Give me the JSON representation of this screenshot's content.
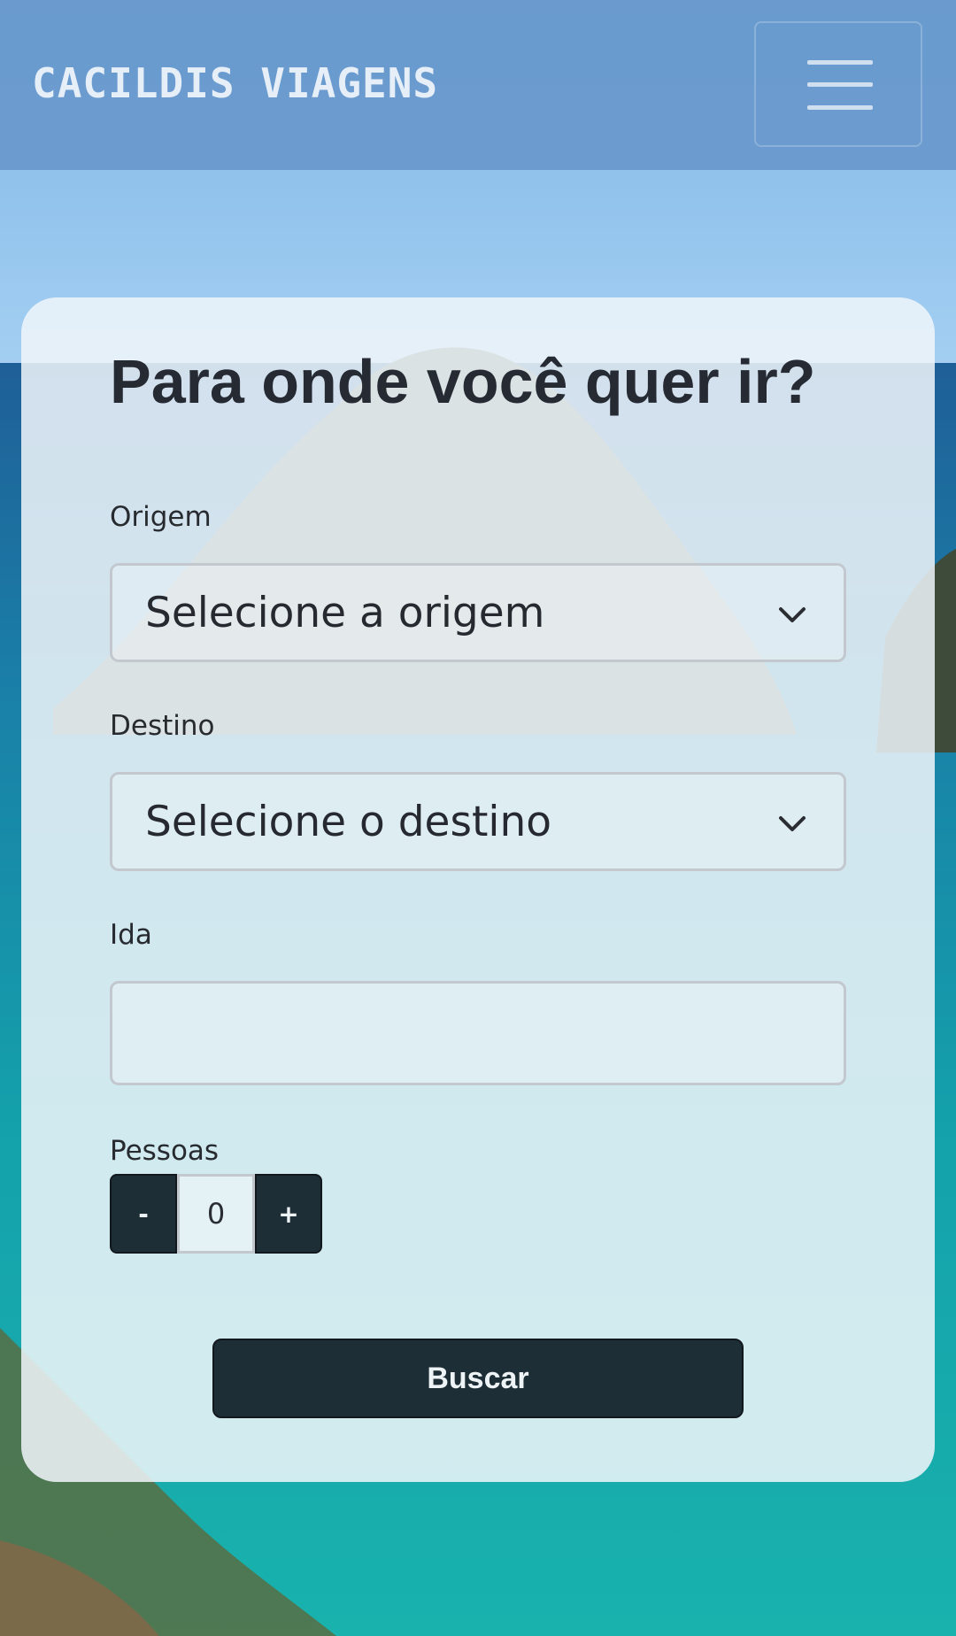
{
  "navbar": {
    "brand": "CACILDIS VIAGENS",
    "menu_icon": "hamburger-menu-icon"
  },
  "form": {
    "title": "Para onde você quer ir?",
    "origin": {
      "label": "Origem",
      "value": "Selecione a origem",
      "icon": "chevron-down-icon"
    },
    "destination": {
      "label": "Destino",
      "value": "Selecione o destino",
      "icon": "chevron-down-icon"
    },
    "departure": {
      "label": "Ida",
      "value": ""
    },
    "people": {
      "label": "Pessoas",
      "decrement_label": "-",
      "value": "0",
      "increment_label": "+"
    },
    "submit_label": "Buscar"
  },
  "colors": {
    "navbar_bg": "#6898cc",
    "button_dark": "#1e2e36",
    "title_text": "#262a33",
    "sky": "#8ec4ef",
    "sea": "#15a3ad"
  }
}
